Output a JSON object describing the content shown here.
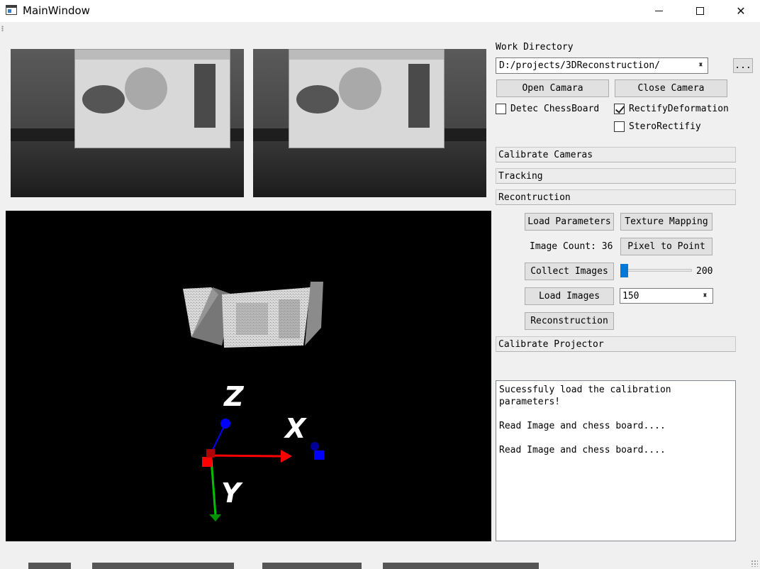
{
  "window": {
    "title": "MainWindow",
    "min_icon": "minimize-icon",
    "max_icon": "maximize-icon",
    "close_icon": "close-icon",
    "close_glyph": "✕"
  },
  "work_directory": {
    "label": "Work Directory",
    "path": "D:/projects/3DReconstruction/",
    "browse_label": "..."
  },
  "camera": {
    "open_label": "Open Camara",
    "close_label": "Close Camera",
    "detect_chessboard": {
      "label": "Detec ChessBoard",
      "checked": false
    },
    "rectify_deformation": {
      "label": "RectifyDeformation",
      "checked": true
    },
    "stereo_rectify": {
      "label": "SteroRectifiy",
      "checked": false
    }
  },
  "sections": {
    "calibrate_cameras": "Calibrate Cameras",
    "tracking": "Tracking",
    "reconstruction": "Recontruction",
    "calibrate_projector": "Calibrate Projector"
  },
  "reconstruction": {
    "load_parameters": "Load Parameters",
    "texture_mapping": "Texture Mapping",
    "image_count_label": "Image Count: 36",
    "pixel_to_point": "Pixel to Point",
    "collect_images": "Collect Images",
    "slider_max_label": "200",
    "slider_value_fraction": 0.0,
    "load_images": "Load Images",
    "spin_value": "150",
    "reconstruction_button": "Reconstruction"
  },
  "viewer": {
    "axis_x": "X",
    "axis_y": "Y",
    "axis_z": "Z",
    "colors": {
      "x": "#ff0000",
      "y": "#00c000",
      "z": "#0000ff"
    }
  },
  "log": {
    "text": "Sucessfuly load the calibration\nparameters!\n\nRead Image and chess board....\n\nRead Image and chess board...."
  }
}
